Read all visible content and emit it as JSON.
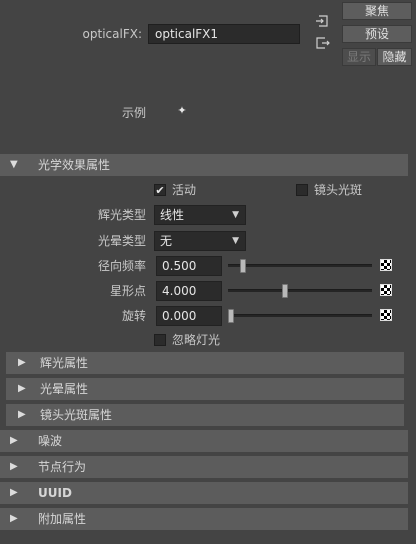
{
  "node": {
    "label": "opticalFX:",
    "name": "opticalFX1"
  },
  "buttons": {
    "focus": "聚焦",
    "presets": "预设",
    "show": "显示",
    "hide": "隐藏"
  },
  "sample": {
    "label": "示例",
    "swatch_glyph": "✦"
  },
  "sections": {
    "optical_fx": "光学效果属性",
    "glow": "辉光属性",
    "halo": "光晕属性",
    "lens_flare": "镜头光斑属性",
    "noise": "噪波",
    "node_behavior": "节点行为",
    "uuid": "UUID",
    "extra": "附加属性"
  },
  "optical": {
    "active_label": "活动",
    "active_checked": true,
    "lens_flare_label": "镜头光斑",
    "lens_flare_checked": false,
    "glow_type_label": "辉光类型",
    "glow_type_value": "线性",
    "halo_type_label": "光晕类型",
    "halo_type_value": "无",
    "radial_freq_label": "径向频率",
    "radial_freq_value": "0.500",
    "radial_freq_slider": 0.5,
    "star_points_label": "星形点",
    "star_points_value": "4.000",
    "rotation_label": "旋转",
    "rotation_value": "0.000",
    "ignore_lights_label": "忽略灯光",
    "ignore_lights_checked": false
  },
  "glyphs": {
    "expanded": "▼",
    "collapsed": "▶",
    "dropdown": "▼",
    "check": "✔"
  },
  "colors": {
    "background": "#444444",
    "section_header": "#5c5c5c",
    "field": "#2b2b2b"
  }
}
